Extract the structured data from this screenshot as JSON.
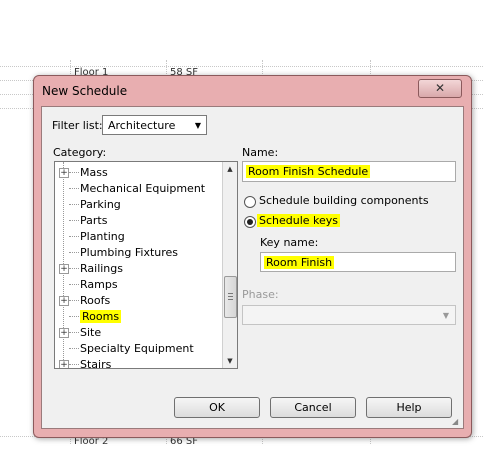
{
  "background": {
    "rows": [
      {
        "name": "Floor 1",
        "area": "58 SF"
      },
      {
        "name": "Floor 2",
        "area": "66 SF"
      }
    ]
  },
  "dialog": {
    "title": "New Schedule",
    "close_icon": "close-icon"
  },
  "filter": {
    "label": "Filter list:",
    "value": "Architecture"
  },
  "category": {
    "label": "Category:",
    "items": [
      {
        "label": "Mass",
        "expandable": true
      },
      {
        "label": "Mechanical Equipment",
        "expandable": false
      },
      {
        "label": "Parking",
        "expandable": false
      },
      {
        "label": "Parts",
        "expandable": false
      },
      {
        "label": "Planting",
        "expandable": false
      },
      {
        "label": "Plumbing Fixtures",
        "expandable": false
      },
      {
        "label": "Railings",
        "expandable": true
      },
      {
        "label": "Ramps",
        "expandable": false
      },
      {
        "label": "Roofs",
        "expandable": true
      },
      {
        "label": "Rooms",
        "expandable": false,
        "selected": true
      },
      {
        "label": "Site",
        "expandable": true
      },
      {
        "label": "Specialty Equipment",
        "expandable": false
      },
      {
        "label": "Stairs",
        "expandable": true
      }
    ]
  },
  "name": {
    "label": "Name:",
    "value": "Room Finish Schedule"
  },
  "options": {
    "building_components_label": "Schedule building components",
    "schedule_keys_label": "Schedule keys",
    "selected": "schedule_keys"
  },
  "key_name": {
    "label": "Key name:",
    "value": "Room Finish"
  },
  "phase": {
    "label": "Phase:",
    "value": ""
  },
  "buttons": {
    "ok": "OK",
    "cancel": "Cancel",
    "help": "Help"
  },
  "colors": {
    "highlight": "#ffff00",
    "frame": "#e8aeb0"
  }
}
